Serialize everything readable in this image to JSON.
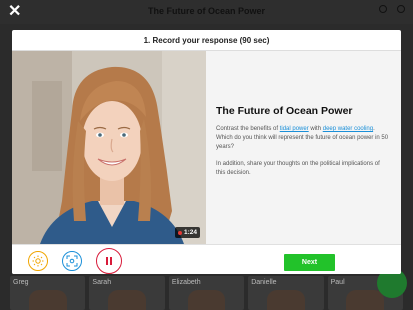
{
  "background": {
    "title": "The Future of Ocean Power",
    "tiles": [
      "Greg",
      "Sarah",
      "Elizabeth",
      "Danielle",
      "Paul"
    ]
  },
  "modal": {
    "header": "1. Record your response (90 sec)",
    "video": {
      "timer": "1:24"
    },
    "prompt": {
      "title": "The Future of Ocean Power",
      "p1_before": "Contrast the benefits of ",
      "link1": "tidal power",
      "p1_mid": " with ",
      "link2": "deep water cooling",
      "p1_after": ". Which do you think will represent the future of ocean power in 50 years?",
      "p2": "In addition, share your thoughts on the political implications of this decision."
    },
    "controls": {
      "brightness_icon": "sun-icon",
      "focus_icon": "focus-frame-icon",
      "pause_icon": "pause-icon"
    },
    "next_label": "Next"
  },
  "colors": {
    "next": "#22c22a",
    "link": "#1a8fd8",
    "pause": "#d81b3a",
    "brightness": "#f0a500"
  }
}
